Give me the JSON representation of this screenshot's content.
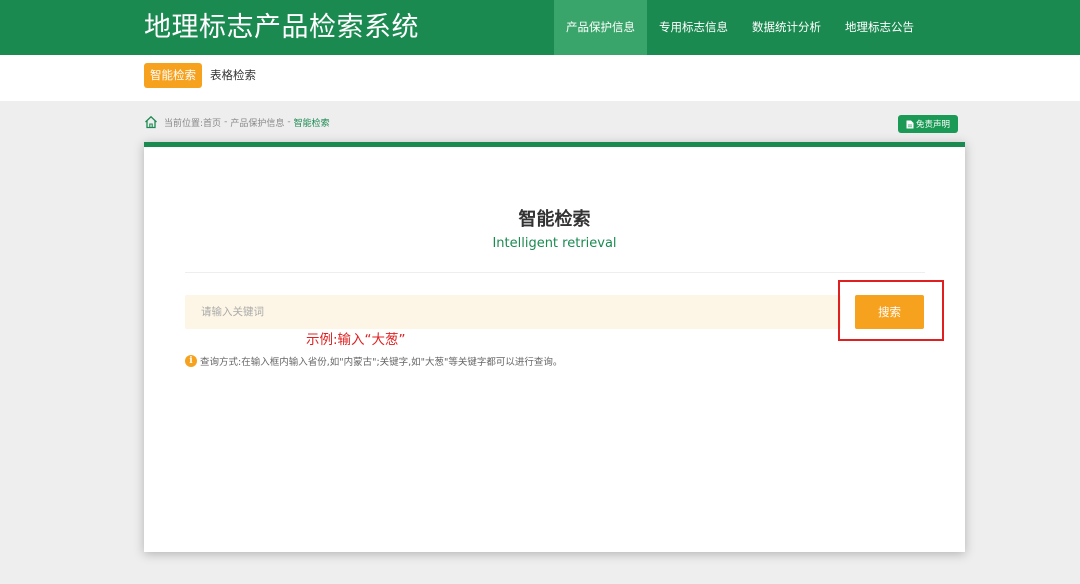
{
  "header": {
    "site_title": "地理标志产品检索系统",
    "nav": [
      {
        "label": "产品保护信息",
        "active": true
      },
      {
        "label": "专用标志信息",
        "active": false
      },
      {
        "label": "数据统计分析",
        "active": false
      },
      {
        "label": "地理标志公告",
        "active": false
      }
    ]
  },
  "subnav": {
    "tabs": [
      {
        "label": "智能检索",
        "active": true
      },
      {
        "label": "表格检索",
        "active": false
      }
    ]
  },
  "breadcrumb": {
    "prefix": "当前位置:",
    "items": [
      "首页",
      "产品保护信息",
      "智能检索"
    ],
    "separator": "-",
    "home_icon": "home-icon"
  },
  "disclaimer": {
    "label": "免责声明",
    "icon": "document-icon"
  },
  "main": {
    "title": "智能检索",
    "subtitle": "Intelligent retrieval",
    "search": {
      "placeholder": "请输入关键词",
      "value": "",
      "button_label": "搜索"
    },
    "annotation": "示例:输入“大葱”",
    "hint": "查询方式:在输入框内输入省份,如\"内蒙古\";关键字,如\"大葱\"等关键字都可以进行查询。",
    "hint_icon": "info-icon"
  },
  "colors": {
    "primary_green": "#1b8a51",
    "nav_active": "#3aa56b",
    "accent_orange": "#f7a21f",
    "annotation_red": "#e02020",
    "input_bg": "#fdf6e6"
  }
}
